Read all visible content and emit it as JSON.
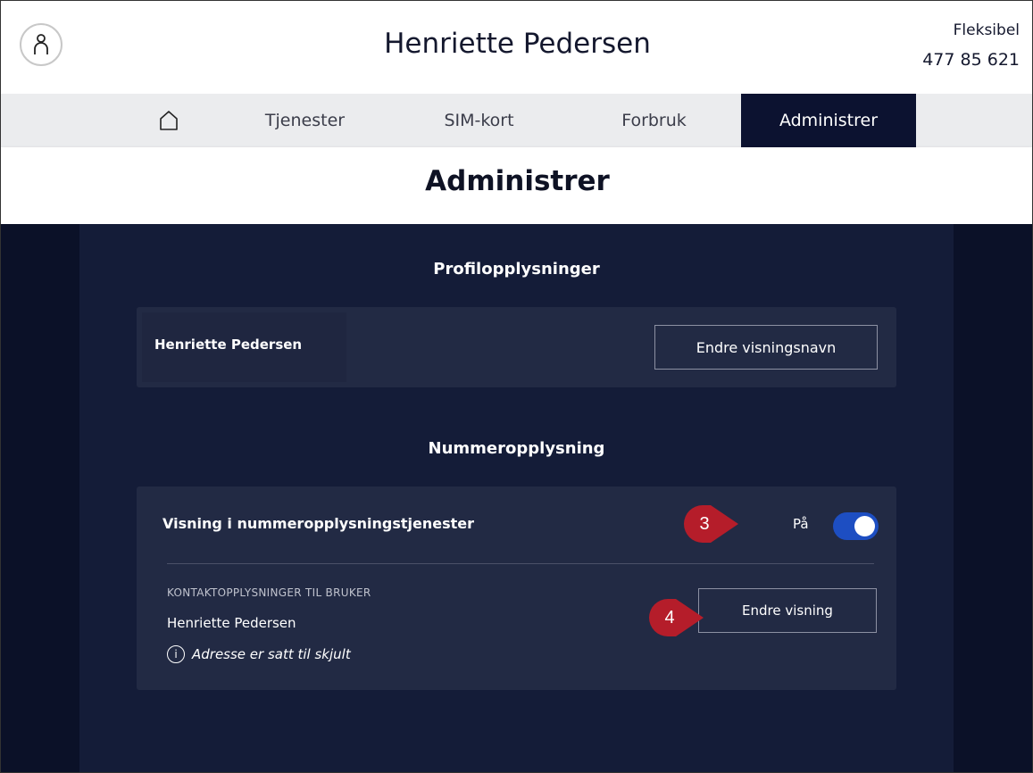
{
  "header": {
    "user_name": "Henriette Pedersen",
    "plan": "Fleksibel",
    "phone": "477 85 621"
  },
  "nav": {
    "items": [
      {
        "label": "Tjenester"
      },
      {
        "label": "SIM-kort"
      },
      {
        "label": "Forbruk"
      },
      {
        "label": "Administrer"
      }
    ],
    "active": "Administrer"
  },
  "page": {
    "title": "Administrer"
  },
  "profile": {
    "section_title": "Profilopplysninger",
    "display_name": "Henriette Pedersen",
    "change_button": "Endre visningsnavn"
  },
  "directory": {
    "section_title": "Nummeropplysning",
    "visibility_label": "Visning i nummeropplysningstjenester",
    "toggle_state": "På",
    "toggle_on": true,
    "contact_heading": "KONTAKTOPPLYSNINGER TIL BRUKER",
    "contact_name": "Henriette Pedersen",
    "address_note": "Adresse er satt til skjult",
    "change_button": "Endre visning"
  },
  "annotations": {
    "marker_3": "3",
    "marker_4": "4"
  },
  "colors": {
    "nav_active_bg": "#0c1230",
    "content_bg": "#141c38",
    "card_bg": "#222a44",
    "toggle_on": "#1d4ec2",
    "marker": "#b51d2a"
  }
}
